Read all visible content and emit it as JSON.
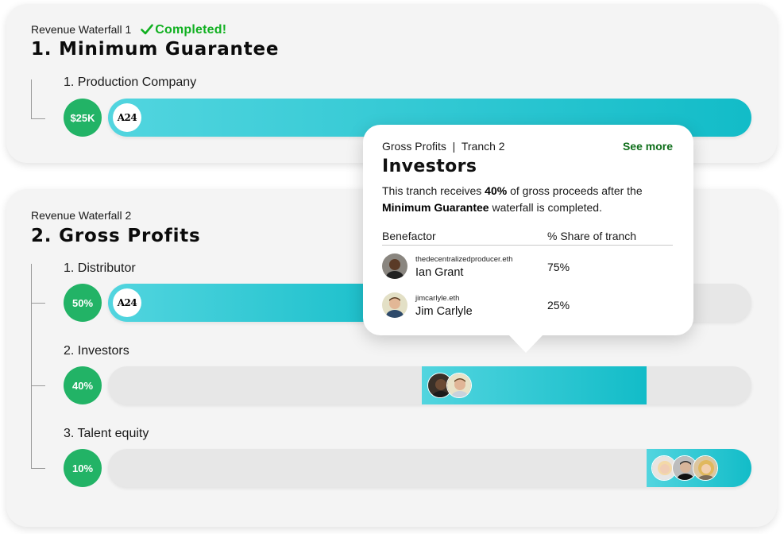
{
  "waterfall1": {
    "eyebrow": "Revenue Waterfall 1",
    "status": "Completed!",
    "title": "1. Minimum Guarantee",
    "rows": [
      {
        "label": "1. Production Company",
        "amount": "$25K",
        "logo": "A24",
        "fill_fraction": 1.0
      }
    ]
  },
  "waterfall2": {
    "eyebrow": "Revenue Waterfall 2",
    "title": "2. Gross Profits",
    "rows": [
      {
        "label": "1. Distributor",
        "amount": "50%",
        "logo": "A24"
      },
      {
        "label": "2. Investors",
        "amount": "40%"
      },
      {
        "label": "3. Talent equity",
        "amount": "10%"
      }
    ]
  },
  "popover": {
    "eyebrow": "Gross Profits  |  Tranch 2",
    "see_more": "See more",
    "title": "Investors",
    "desc_part1": "This tranch receives ",
    "desc_bold1": "40%",
    "desc_part2": " of gross proceeds after the ",
    "desc_bold2": "Minimum Guarantee",
    "desc_part3": " waterfall is completed.",
    "col_benefactor": "Benefactor",
    "col_share": "% Share of tranch",
    "benefactors": [
      {
        "handle": "thedecentralizedproducer.eth",
        "name": "Ian Grant",
        "share": "75%",
        "avatar_icon": "person-avatar-icon"
      },
      {
        "handle": "jimcarlyle.eth",
        "name": "Jim Carlyle",
        "share": "25%",
        "avatar_icon": "person-avatar-icon"
      }
    ]
  },
  "colors": {
    "accent_teal": "#12bcc8",
    "accent_teal_light": "#52d5df",
    "pill_green": "#22b366",
    "status_green": "#10b020",
    "see_more_green": "#0e6e1a",
    "track_gray": "#e7e7e7"
  }
}
